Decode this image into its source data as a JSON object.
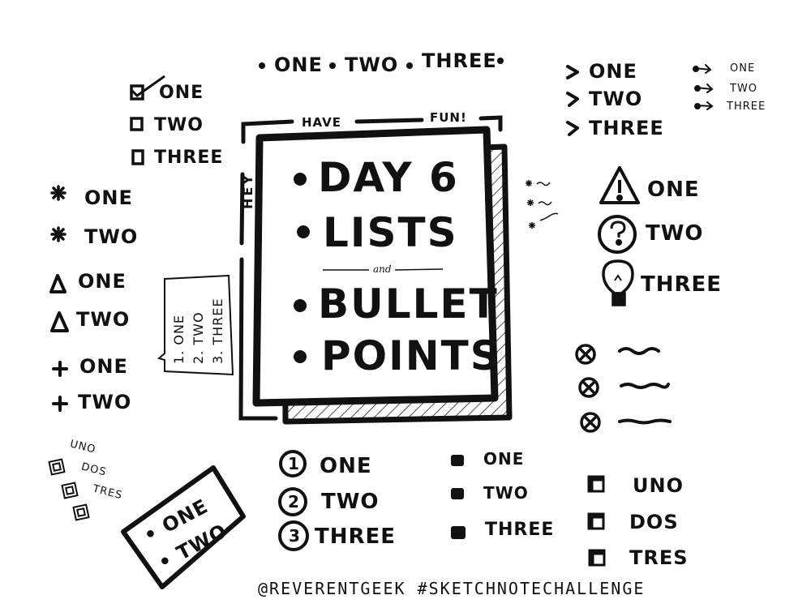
{
  "top_row": {
    "one": "ONE",
    "two": "TWO",
    "three": "THREE"
  },
  "frame_labels": {
    "have": "HAVE",
    "fun": "FUN!",
    "hey": "HEY"
  },
  "center": {
    "line1": "DAY 6",
    "line2": "LISTS",
    "and": "and",
    "line3": "BULLET",
    "line4": "POINTS"
  },
  "checkbox_list": [
    "ONE",
    "TWO",
    "THREE"
  ],
  "asterisk_list": [
    "ONE",
    "TWO"
  ],
  "triangle_list": [
    "ONE",
    "TWO"
  ],
  "plus_list": [
    "ONE",
    "TWO"
  ],
  "note_list": [
    "1. ONE",
    "2. TWO",
    "3. THREE"
  ],
  "small_spanish_list": [
    "UNO",
    "DOS",
    "TRES"
  ],
  "tilted_card": [
    "ONE",
    "TWO"
  ],
  "numbered_list": [
    {
      "num": "1",
      "label": "ONE"
    },
    {
      "num": "2",
      "label": "TWO"
    },
    {
      "num": "3",
      "label": "THREE"
    }
  ],
  "square_list": [
    "ONE",
    "TWO",
    "THREE"
  ],
  "cube_list": [
    "UNO",
    "DOS",
    "TRES"
  ],
  "arrow_list": [
    "ONE",
    "TWO",
    "THREE"
  ],
  "small_arrow_list": [
    "ONE",
    "TWO",
    "THREE"
  ],
  "icon_list": [
    {
      "icon": "warning-triangle-icon",
      "label": "ONE"
    },
    {
      "icon": "question-circle-icon",
      "label": "TWO"
    },
    {
      "icon": "lightbulb-icon",
      "label": "THREE"
    }
  ],
  "footer": "@REVERENTGEEK   #SKETCHNOTECHALLENGE",
  "colors": {
    "ink": "#111111",
    "paper": "#ffffff"
  }
}
